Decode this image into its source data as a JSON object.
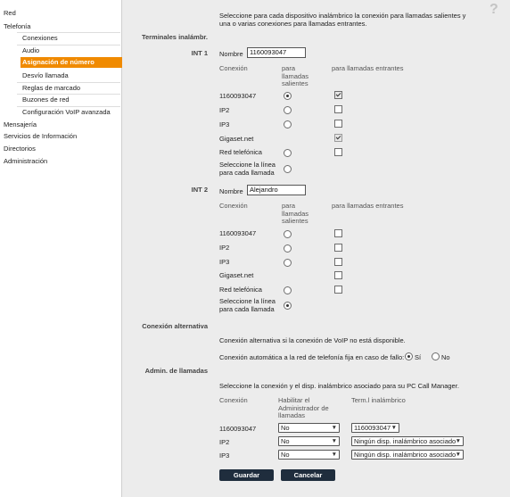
{
  "sidebar": {
    "items": [
      {
        "label": "Red"
      },
      {
        "label": "Telefonía"
      },
      {
        "label": "Conexiones"
      },
      {
        "label": "Audio"
      },
      {
        "label": "Asignación de número"
      },
      {
        "label": "Desvío llamada"
      },
      {
        "label": "Reglas de marcado"
      },
      {
        "label": "Buzones de red"
      },
      {
        "label": "Configuración VoIP avanzada"
      },
      {
        "label": "Mensajería"
      },
      {
        "label": "Servicios de Información"
      },
      {
        "label": "Directorios"
      },
      {
        "label": "Administración"
      }
    ],
    "active_index": 4,
    "accent_color": "#f08a00"
  },
  "help": {
    "icon": "question-mark-icon",
    "glyph": "?"
  },
  "intro": {
    "line1": "Seleccione para cada dispositivo inalámbrico la conexión para llamadas salientes y",
    "line2": "una o varias conexiones para llamadas entrantes."
  },
  "terminals": {
    "section_label": "Terminales inalámbr.",
    "col_connection": "Conexión",
    "col_out": [
      "para",
      "llamadas",
      "salientes"
    ],
    "col_in": "para llamadas entrantes",
    "name_label": "Nombre",
    "int1": {
      "label": "INT 1",
      "name": "1160093047",
      "rows": [
        {
          "label": "1160093047",
          "out": true,
          "in": true
        },
        {
          "label": "IP2",
          "out": false,
          "in": false
        },
        {
          "label": "IP3",
          "out": false,
          "in": false
        },
        {
          "label": "Gigaset.net",
          "in": true
        },
        {
          "label": "Red telefónica",
          "out": false,
          "in": false
        },
        {
          "label": [
            "Seleccione la línea",
            "para cada llamada"
          ],
          "out": false
        }
      ]
    },
    "int2": {
      "label": "INT 2",
      "name": "Alejandro",
      "rows": [
        {
          "label": "1160093047",
          "out": false,
          "in": false
        },
        {
          "label": "IP2",
          "out": false,
          "in": false
        },
        {
          "label": "IP3",
          "out": false,
          "in": false
        },
        {
          "label": "Gigaset.net",
          "in": false
        },
        {
          "label": "Red telefónica",
          "out": false,
          "in": false
        },
        {
          "label": [
            "Seleccione la línea",
            "para cada llamada"
          ],
          "out": true
        }
      ]
    }
  },
  "alternative": {
    "section_label": "Conexión alternativa",
    "desc": "Conexión alternativa si la conexión de VoIP no está disponible.",
    "question": "Conexión automática a la red de telefonía fija en caso de fallo:",
    "yes_label": "Sí",
    "no_label": "No",
    "selected": "yes"
  },
  "call_manager": {
    "section_label": "Admin. de llamadas",
    "desc": "Seleccione la conexión y el disp. inalámbrico asociado para su PC Call Manager.",
    "col_connection": "Conexión",
    "col_enable": [
      "Habilitar el",
      "Administrador de",
      "llamadas"
    ],
    "col_handset": "Term.l inalámbrico",
    "rows": [
      {
        "label": "1160093047",
        "enable": "No",
        "handset": "1160093047"
      },
      {
        "label": "IP2",
        "enable": "No",
        "handset": "Ningún disp. inalámbrico asociado"
      },
      {
        "label": "IP3",
        "enable": "No",
        "handset": "Ningún disp. inalámbrico asociado"
      }
    ]
  },
  "buttons": {
    "save": "Guardar",
    "cancel": "Cancelar"
  }
}
